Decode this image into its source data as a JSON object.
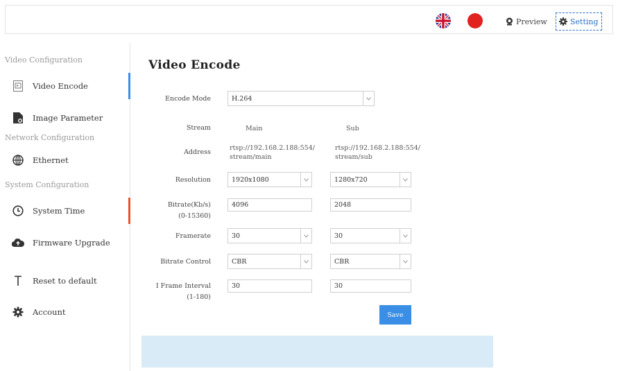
{
  "header": {
    "preview_label": "Preview",
    "setting_label": "Setting"
  },
  "sidebar": {
    "section_video": "Video Configuration",
    "video_encode": "Video Encode",
    "image_parameter": "Image Parameter",
    "section_network": "Network Configuration",
    "ethernet": "Ethernet",
    "section_system": "System Configuration",
    "system_time": "System Time",
    "firmware_upgrade": "Firmware Upgrade",
    "reset_default": "Reset to default",
    "account": "Account"
  },
  "main": {
    "title": "Video Encode",
    "encode_mode_label": "Encode Mode",
    "encode_mode_value": "H.264",
    "stream_label": "Stream",
    "stream_main": "Main",
    "stream_sub": "Sub",
    "address_label": "Address",
    "address_main_1": "rtsp://192.168.2.188:554/",
    "address_main_2": "stream/main",
    "address_sub_1": "rtsp://192.168.2.188:554/",
    "address_sub_2": "stream/sub",
    "resolution_label": "Resolution",
    "resolution_main": "1920x1080",
    "resolution_sub": "1280x720",
    "bitrate_label_1": "Bitrate(Kb/s)",
    "bitrate_label_2": "(0-15360)",
    "bitrate_main": "4096",
    "bitrate_sub": "2048",
    "framerate_label": "Framerate",
    "framerate_main": "30",
    "framerate_sub": "30",
    "bitrate_control_label": "Bitrate Control",
    "bitrate_control_main": "CBR",
    "bitrate_control_sub": "CBR",
    "iframe_label_1": "I Frame Interval",
    "iframe_label_2": "(1-180)",
    "iframe_main": "30",
    "iframe_sub": "30",
    "save_label": "Save"
  },
  "colors": {
    "accent_blue": "#3a8ee6",
    "active_orange": "#e9542e",
    "info_box": "#d8ebf7"
  }
}
